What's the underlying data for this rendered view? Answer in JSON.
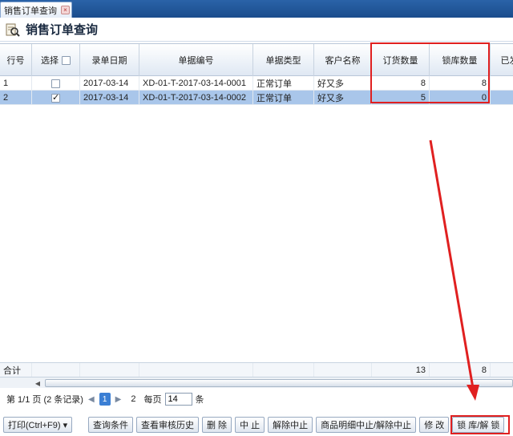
{
  "tab": {
    "label": "销售订单查询",
    "close": "×"
  },
  "page": {
    "title": "销售订单查询"
  },
  "columns": [
    "行号",
    "选择",
    "录单日期",
    "单据编号",
    "单据类型",
    "客户名称",
    "订货数量",
    "锁库数量",
    "已发"
  ],
  "rows": [
    {
      "no": "1",
      "checked": false,
      "date": "2017-03-14",
      "code": "XD-01-T-2017-03-14-0001",
      "type": "正常订单",
      "customer": "好又多",
      "order_qty": "8",
      "lock_qty": "8"
    },
    {
      "no": "2",
      "checked": true,
      "date": "2017-03-14",
      "code": "XD-01-T-2017-03-14-0002",
      "type": "正常订单",
      "customer": "好又多",
      "order_qty": "5",
      "lock_qty": "0"
    }
  ],
  "totals": {
    "label": "合计",
    "order_qty": "13",
    "lock_qty": "8"
  },
  "pager": {
    "page_info": "第 1/1 页 (2 条记录)",
    "first": "◀",
    "prev": "▏◀",
    "current": "1",
    "next": "▶",
    "last": "2",
    "per_page_label": "每页",
    "per_page_value": "14",
    "unit": "条"
  },
  "toolbar": {
    "print": "打印(Ctrl+F9) ▾",
    "query": "查询条件",
    "history": "查看审核历史",
    "delete": "删 除",
    "stop": "中 止",
    "unstop": "解除中止",
    "item_stop": "商品明细中止/解除中止",
    "edit": "修 改",
    "lock": "锁 库/解 锁"
  },
  "colors": {
    "highlight": "#e02020",
    "selected_row": "#a9c6ea",
    "tabbar": "#1f55a0"
  }
}
